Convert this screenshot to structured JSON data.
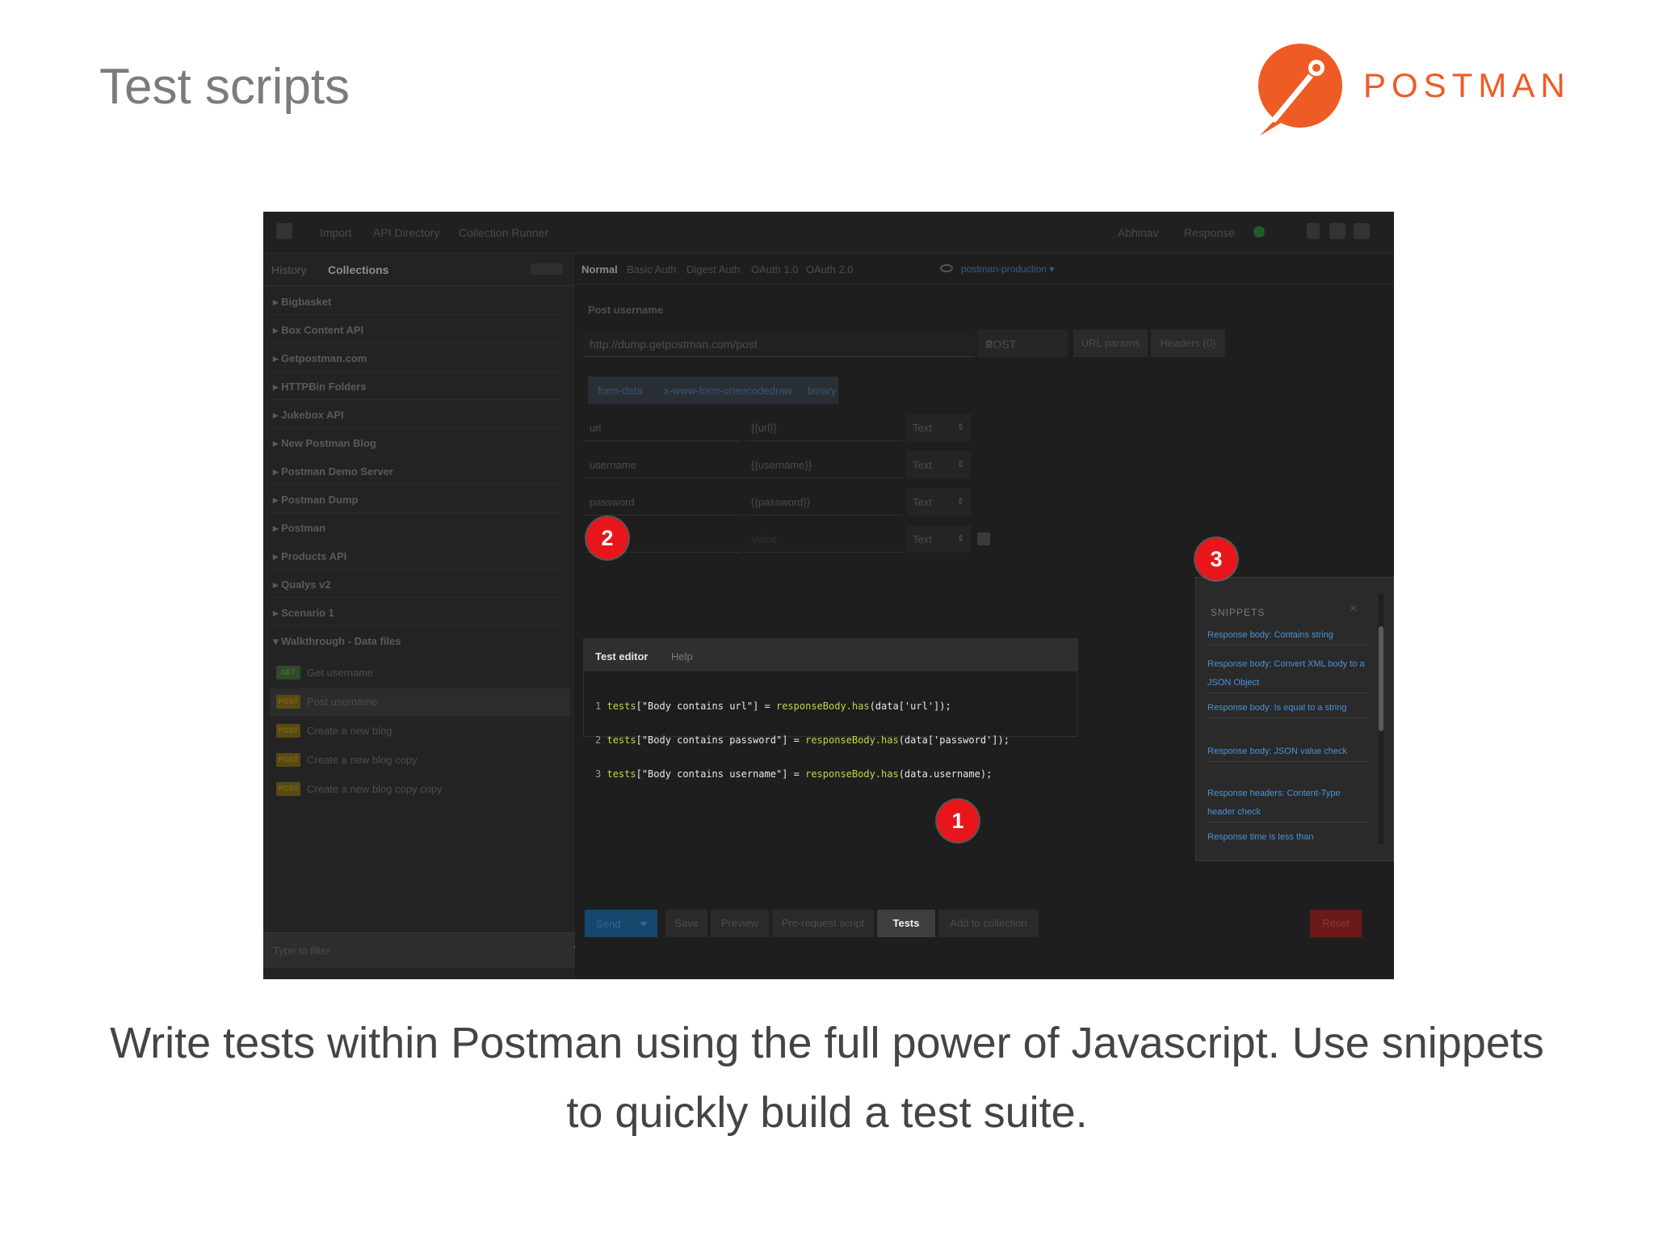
{
  "slide": {
    "title": "Test scripts",
    "brand": "POSTMAN",
    "caption_line1": "Write tests within Postman using the full power of Javascript. Use snippets",
    "caption_line2": "to quickly build a test suite.",
    "accent_color": "#ef5b25"
  },
  "app": {
    "topbar": {
      "items": [
        "Import",
        "API Directory",
        "Collection Runner"
      ],
      "right_items": [
        "Abhinav",
        "Response"
      ]
    },
    "sidebar": {
      "tabs": [
        "History",
        "Collections"
      ],
      "collections": [
        "Bigbasket",
        "Box Content API",
        "Getpostman.com",
        "HTTPBin Folders",
        "Jukebox API",
        "New Postman Blog",
        "Postman Demo Server",
        "Postman Dump",
        "Postman",
        "Products API",
        "Qualys v2",
        "Scenario 1",
        "Walkthrough - Data files"
      ],
      "requests": [
        {
          "method": "GET",
          "name": "Get username"
        },
        {
          "method": "POST",
          "name": "Post username"
        },
        {
          "method": "POST",
          "name": "Create a new blog"
        },
        {
          "method": "POST",
          "name": "Create a new blog copy"
        },
        {
          "method": "POST",
          "name": "Create a new blog copy copy"
        }
      ],
      "filter_placeholder": "Type to filter"
    },
    "auth_tabs": [
      "Normal",
      "Basic Auth",
      "Digest Auth",
      "OAuth 1.0",
      "OAuth 2.0"
    ],
    "environment": "postman-production",
    "request_name": "Post username",
    "url": "http://dump.getpostman.com/post",
    "method": "POST",
    "url_params_label": "URL params",
    "headers_label": "Headers (0)",
    "body_tabs": [
      "form-data",
      "x-www-form-urlencoded",
      "raw",
      "binary"
    ],
    "form_rows": [
      {
        "key": "url",
        "value": "{{url}}",
        "type": "Text"
      },
      {
        "key": "username",
        "value": "{{username}}",
        "type": "Text"
      },
      {
        "key": "password",
        "value": "{{password}}",
        "type": "Text"
      },
      {
        "key": "",
        "value": "Value",
        "type": "Text"
      }
    ],
    "editor": {
      "tabs": [
        "Test editor",
        "Help"
      ],
      "lines": [
        {
          "n": "1",
          "a": "tests",
          "b": "[\"Body contains url\"] = ",
          "c": "responseBody.has",
          "d": "(data['url']);"
        },
        {
          "n": "2",
          "a": "tests",
          "b": "[\"Body contains password\"] = ",
          "c": "responseBody.has",
          "d": "(data['password']);"
        },
        {
          "n": "3",
          "a": "tests",
          "b": "[\"Body contains username\"] = ",
          "c": "responseBody.has",
          "d": "(data.username);"
        }
      ]
    },
    "bottom_buttons": {
      "send": "Send",
      "save": "Save",
      "preview": "Preview",
      "prerequest": "Pre-request script",
      "tests": "Tests",
      "add": "Add to collection",
      "reset": "Reset"
    },
    "snippets": {
      "title": "SNIPPETS",
      "items": [
        "Response body: Contains string",
        "Response body: Convert XML body to a JSON Object",
        "Response body: Is equal to a string",
        "Response body: JSON value check",
        "Response headers: Content-Type header check",
        "Response time is less than"
      ]
    },
    "markers": [
      "1",
      "2",
      "3"
    ]
  }
}
